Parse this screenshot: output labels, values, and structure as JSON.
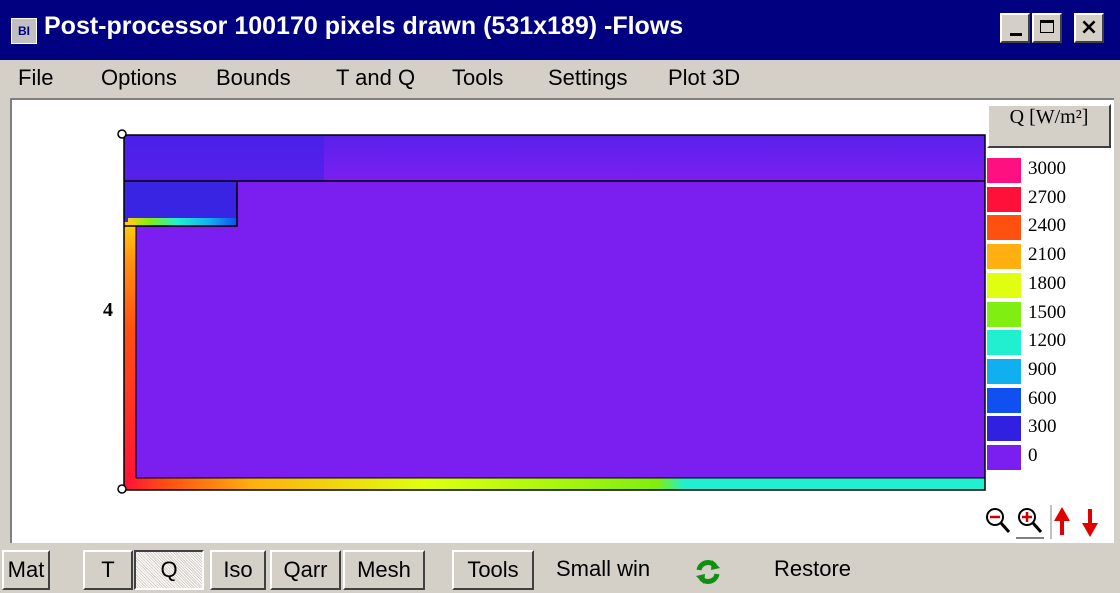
{
  "window": {
    "title": "Post-processor 100170 pixels drawn (531x189) -Flows",
    "icon": "app-icon",
    "icon_text": "BI",
    "controls": {
      "minimize": "minimize-icon",
      "maximize": "maximize-icon",
      "close_symbol": "×"
    }
  },
  "menu": [
    {
      "label": "File"
    },
    {
      "label": "Options"
    },
    {
      "label": "Bounds"
    },
    {
      "label": "T and Q"
    },
    {
      "label": "Tools"
    },
    {
      "label": "Settings"
    },
    {
      "label": "Plot 3D"
    }
  ],
  "plot": {
    "axis_label_left": "4",
    "colors": {
      "background": "#7a1ff0",
      "top_band": "#4a22e8",
      "outline": "#000000"
    }
  },
  "legend": {
    "title": "Q [W/m²]",
    "items": [
      {
        "label": "3000",
        "color": "#ff1080"
      },
      {
        "label": "2700",
        "color": "#ff1038"
      },
      {
        "label": "2400",
        "color": "#ff5010"
      },
      {
        "label": "2100",
        "color": "#ffb010"
      },
      {
        "label": "1800",
        "color": "#e0ff10"
      },
      {
        "label": "1500",
        "color": "#80ee10"
      },
      {
        "label": "1200",
        "color": "#20f0d0"
      },
      {
        "label": "900",
        "color": "#10b0f0"
      },
      {
        "label": "600",
        "color": "#1050f0"
      },
      {
        "label": "300",
        "color": "#3020e0"
      },
      {
        "label": "0",
        "color": "#7a1ff0"
      }
    ]
  },
  "zoom_tools": [
    {
      "name": "zoom-out-icon"
    },
    {
      "name": "zoom-in-icon"
    },
    {
      "name": "arrow-up-icon"
    },
    {
      "name": "arrow-down-icon"
    }
  ],
  "bottombar": {
    "buttons": {
      "mat": "Mat",
      "t": "T",
      "q": "Q",
      "iso": "Iso",
      "qarr": "Qarr",
      "mesh": "Mesh",
      "tools": "Tools"
    },
    "small_win": "Small win",
    "restore": "Restore",
    "refresh_icon": "refresh-icon"
  }
}
